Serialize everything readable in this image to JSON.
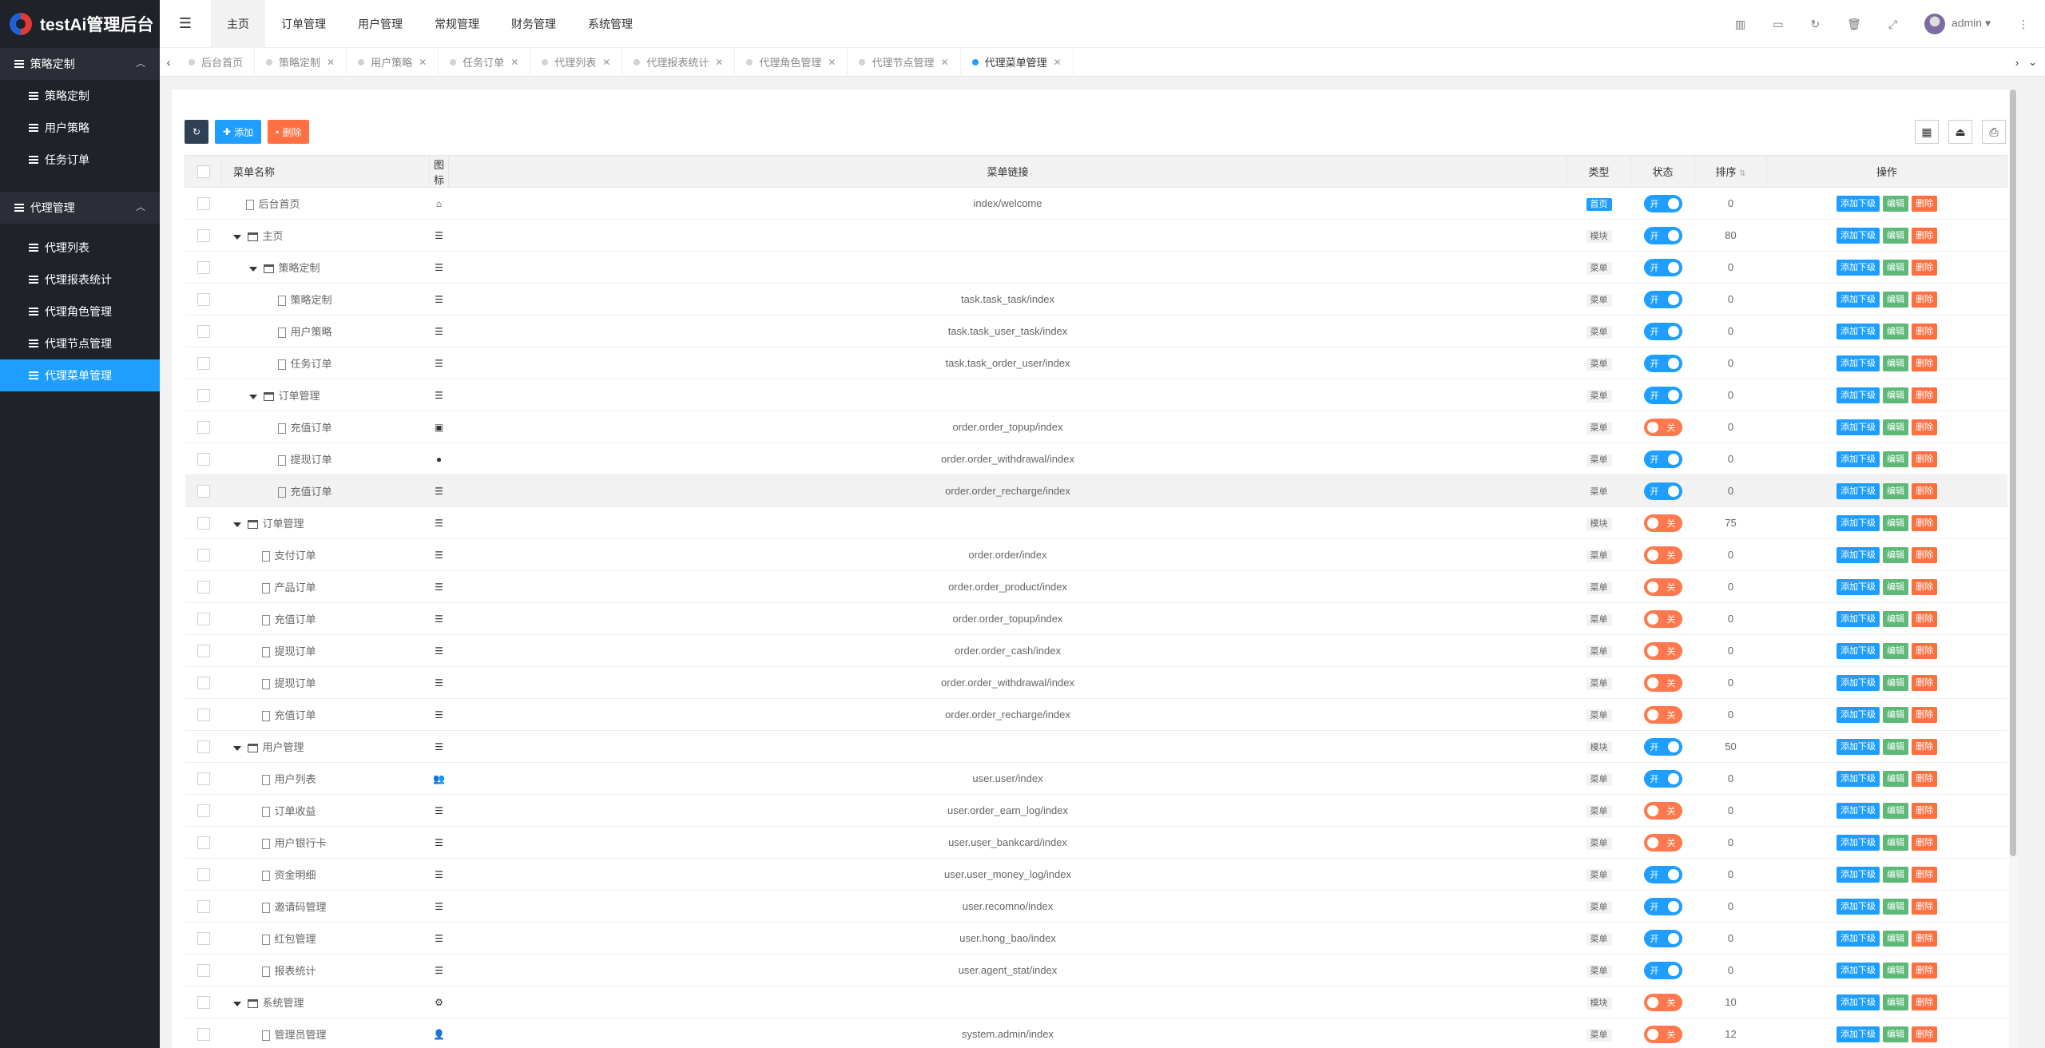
{
  "app": {
    "title": "testAi管理后台"
  },
  "sidebar": {
    "groups": [
      {
        "label": "策略定制",
        "items": [
          {
            "label": "策略定制"
          },
          {
            "label": "用户策略"
          },
          {
            "label": "任务订单"
          }
        ]
      },
      {
        "label": "代理管理",
        "items": [
          {
            "label": "代理列表"
          },
          {
            "label": "代理报表统计"
          },
          {
            "label": "代理角色管理"
          },
          {
            "label": "代理节点管理"
          },
          {
            "label": "代理菜单管理"
          }
        ]
      }
    ]
  },
  "topnav": {
    "items": [
      "主页",
      "订单管理",
      "用户管理",
      "常规管理",
      "财务管理",
      "系统管理"
    ],
    "user": "admin"
  },
  "tabs": [
    "后台首页",
    "策略定制",
    "用户策略",
    "任务订单",
    "代理列表",
    "代理报表统计",
    "代理角色管理",
    "代理节点管理",
    "代理菜单管理"
  ],
  "toolbar": {
    "add": "添加",
    "delete": "删除"
  },
  "table": {
    "headers": {
      "name": "菜单名称",
      "icon": "图标",
      "link": "菜单链接",
      "type": "类型",
      "status": "状态",
      "sort": "排序",
      "ops": "操作"
    },
    "switch": {
      "on": "开",
      "off": "关"
    },
    "ops": {
      "add_child": "添加下级",
      "edit": "编辑",
      "del": "删除"
    },
    "rows": [
      {
        "name": "后台首页",
        "level": 0,
        "folder": false,
        "icon": "home",
        "link": "index/welcome",
        "type": "首页",
        "status": "on",
        "sort": "0"
      },
      {
        "name": "主页",
        "level": 0,
        "folder": true,
        "icon": "list",
        "link": "",
        "type": "模块",
        "status": "on",
        "sort": "80"
      },
      {
        "name": "策略定制",
        "level": 1,
        "folder": true,
        "icon": "list",
        "link": "",
        "type": "菜单",
        "status": "on",
        "sort": "0"
      },
      {
        "name": "策略定制",
        "level": 2,
        "folder": false,
        "icon": "list",
        "link": "task.task_task/index",
        "type": "菜单",
        "status": "on",
        "sort": "0"
      },
      {
        "name": "用户策略",
        "level": 2,
        "folder": false,
        "icon": "list",
        "link": "task.task_user_task/index",
        "type": "菜单",
        "status": "on",
        "sort": "0"
      },
      {
        "name": "任务订单",
        "level": 2,
        "folder": false,
        "icon": "list",
        "link": "task.task_order_user/index",
        "type": "菜单",
        "status": "on",
        "sort": "0"
      },
      {
        "name": "订单管理",
        "level": 1,
        "folder": true,
        "icon": "list",
        "link": "",
        "type": "菜单",
        "status": "on",
        "sort": "0"
      },
      {
        "name": "充值订单",
        "level": 2,
        "folder": false,
        "icon": "money",
        "link": "order.order_topup/index",
        "type": "菜单",
        "status": "off",
        "sort": "0"
      },
      {
        "name": "提现订单",
        "level": 2,
        "folder": false,
        "icon": "circle",
        "link": "order.order_withdrawal/index",
        "type": "菜单",
        "status": "on",
        "sort": "0"
      },
      {
        "name": "充值订单",
        "level": 2,
        "folder": false,
        "icon": "list",
        "link": "order.order_recharge/index",
        "type": "菜单",
        "status": "on",
        "sort": "0",
        "hl": true
      },
      {
        "name": "订单管理",
        "level": 0,
        "folder": true,
        "icon": "list",
        "link": "",
        "type": "模块",
        "status": "off",
        "sort": "75"
      },
      {
        "name": "支付订单",
        "level": 1,
        "folder": false,
        "icon": "list",
        "link": "order.order/index",
        "type": "菜单",
        "status": "off",
        "sort": "0"
      },
      {
        "name": "产品订单",
        "level": 1,
        "folder": false,
        "icon": "list",
        "link": "order.order_product/index",
        "type": "菜单",
        "status": "off",
        "sort": "0"
      },
      {
        "name": "充值订单",
        "level": 1,
        "folder": false,
        "icon": "list",
        "link": "order.order_topup/index",
        "type": "菜单",
        "status": "off",
        "sort": "0"
      },
      {
        "name": "提现订单",
        "level": 1,
        "folder": false,
        "icon": "list",
        "link": "order.order_cash/index",
        "type": "菜单",
        "status": "off",
        "sort": "0"
      },
      {
        "name": "提现订单",
        "level": 1,
        "folder": false,
        "icon": "list",
        "link": "order.order_withdrawal/index",
        "type": "菜单",
        "status": "off",
        "sort": "0"
      },
      {
        "name": "充值订单",
        "level": 1,
        "folder": false,
        "icon": "list",
        "link": "order.order_recharge/index",
        "type": "菜单",
        "status": "off",
        "sort": "0"
      },
      {
        "name": "用户管理",
        "level": 0,
        "folder": true,
        "icon": "list",
        "link": "",
        "type": "模块",
        "status": "on",
        "sort": "50"
      },
      {
        "name": "用户列表",
        "level": 1,
        "folder": false,
        "icon": "users",
        "link": "user.user/index",
        "type": "菜单",
        "status": "on",
        "sort": "0"
      },
      {
        "name": "订单收益",
        "level": 1,
        "folder": false,
        "icon": "list",
        "link": "user.order_earn_log/index",
        "type": "菜单",
        "status": "off",
        "sort": "0"
      },
      {
        "name": "用户银行卡",
        "level": 1,
        "folder": false,
        "icon": "list",
        "link": "user.user_bankcard/index",
        "type": "菜单",
        "status": "off",
        "sort": "0"
      },
      {
        "name": "资金明细",
        "level": 1,
        "folder": false,
        "icon": "list",
        "link": "user.user_money_log/index",
        "type": "菜单",
        "status": "on",
        "sort": "0"
      },
      {
        "name": "邀请码管理",
        "level": 1,
        "folder": false,
        "icon": "list",
        "link": "user.recomno/index",
        "type": "菜单",
        "status": "on",
        "sort": "0"
      },
      {
        "name": "红包管理",
        "level": 1,
        "folder": false,
        "icon": "list",
        "link": "user.hong_bao/index",
        "type": "菜单",
        "status": "on",
        "sort": "0"
      },
      {
        "name": "报表统计",
        "level": 1,
        "folder": false,
        "icon": "list",
        "link": "user.agent_stat/index",
        "type": "菜单",
        "status": "on",
        "sort": "0"
      },
      {
        "name": "系统管理",
        "level": 0,
        "folder": true,
        "icon": "gear",
        "link": "",
        "type": "模块",
        "status": "off",
        "sort": "10"
      },
      {
        "name": "管理员管理",
        "level": 1,
        "folder": false,
        "icon": "user",
        "link": "system.admin/index",
        "type": "菜单",
        "status": "off",
        "sort": "12"
      }
    ]
  },
  "colors": {
    "primary": "#1e9fff",
    "danger": "#ff5722",
    "success": "#5fb878",
    "dark": "#2f4056",
    "sidebar": "#20222a"
  }
}
